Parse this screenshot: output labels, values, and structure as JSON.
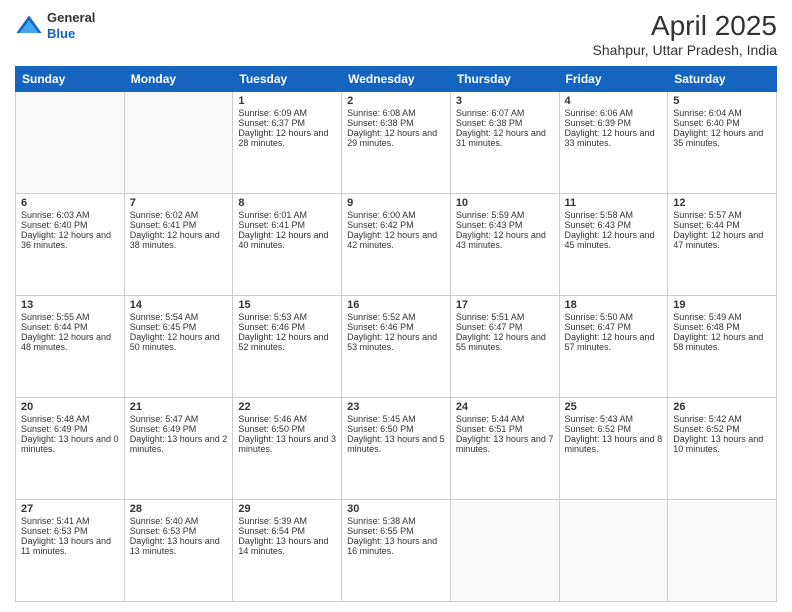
{
  "header": {
    "logo": {
      "general": "General",
      "blue": "Blue"
    },
    "title": "April 2025",
    "subtitle": "Shahpur, Uttar Pradesh, India"
  },
  "calendar": {
    "headers": [
      "Sunday",
      "Monday",
      "Tuesday",
      "Wednesday",
      "Thursday",
      "Friday",
      "Saturday"
    ],
    "rows": [
      [
        {
          "day": "",
          "content": ""
        },
        {
          "day": "",
          "content": ""
        },
        {
          "day": "1",
          "content": "Sunrise: 6:09 AM\nSunset: 6:37 PM\nDaylight: 12 hours and 28 minutes."
        },
        {
          "day": "2",
          "content": "Sunrise: 6:08 AM\nSunset: 6:38 PM\nDaylight: 12 hours and 29 minutes."
        },
        {
          "day": "3",
          "content": "Sunrise: 6:07 AM\nSunset: 6:38 PM\nDaylight: 12 hours and 31 minutes."
        },
        {
          "day": "4",
          "content": "Sunrise: 6:06 AM\nSunset: 6:39 PM\nDaylight: 12 hours and 33 minutes."
        },
        {
          "day": "5",
          "content": "Sunrise: 6:04 AM\nSunset: 6:40 PM\nDaylight: 12 hours and 35 minutes."
        }
      ],
      [
        {
          "day": "6",
          "content": "Sunrise: 6:03 AM\nSunset: 6:40 PM\nDaylight: 12 hours and 36 minutes."
        },
        {
          "day": "7",
          "content": "Sunrise: 6:02 AM\nSunset: 6:41 PM\nDaylight: 12 hours and 38 minutes."
        },
        {
          "day": "8",
          "content": "Sunrise: 6:01 AM\nSunset: 6:41 PM\nDaylight: 12 hours and 40 minutes."
        },
        {
          "day": "9",
          "content": "Sunrise: 6:00 AM\nSunset: 6:42 PM\nDaylight: 12 hours and 42 minutes."
        },
        {
          "day": "10",
          "content": "Sunrise: 5:59 AM\nSunset: 6:43 PM\nDaylight: 12 hours and 43 minutes."
        },
        {
          "day": "11",
          "content": "Sunrise: 5:58 AM\nSunset: 6:43 PM\nDaylight: 12 hours and 45 minutes."
        },
        {
          "day": "12",
          "content": "Sunrise: 5:57 AM\nSunset: 6:44 PM\nDaylight: 12 hours and 47 minutes."
        }
      ],
      [
        {
          "day": "13",
          "content": "Sunrise: 5:55 AM\nSunset: 6:44 PM\nDaylight: 12 hours and 48 minutes."
        },
        {
          "day": "14",
          "content": "Sunrise: 5:54 AM\nSunset: 6:45 PM\nDaylight: 12 hours and 50 minutes."
        },
        {
          "day": "15",
          "content": "Sunrise: 5:53 AM\nSunset: 6:46 PM\nDaylight: 12 hours and 52 minutes."
        },
        {
          "day": "16",
          "content": "Sunrise: 5:52 AM\nSunset: 6:46 PM\nDaylight: 12 hours and 53 minutes."
        },
        {
          "day": "17",
          "content": "Sunrise: 5:51 AM\nSunset: 6:47 PM\nDaylight: 12 hours and 55 minutes."
        },
        {
          "day": "18",
          "content": "Sunrise: 5:50 AM\nSunset: 6:47 PM\nDaylight: 12 hours and 57 minutes."
        },
        {
          "day": "19",
          "content": "Sunrise: 5:49 AM\nSunset: 6:48 PM\nDaylight: 12 hours and 58 minutes."
        }
      ],
      [
        {
          "day": "20",
          "content": "Sunrise: 5:48 AM\nSunset: 6:49 PM\nDaylight: 13 hours and 0 minutes."
        },
        {
          "day": "21",
          "content": "Sunrise: 5:47 AM\nSunset: 6:49 PM\nDaylight: 13 hours and 2 minutes."
        },
        {
          "day": "22",
          "content": "Sunrise: 5:46 AM\nSunset: 6:50 PM\nDaylight: 13 hours and 3 minutes."
        },
        {
          "day": "23",
          "content": "Sunrise: 5:45 AM\nSunset: 6:50 PM\nDaylight: 13 hours and 5 minutes."
        },
        {
          "day": "24",
          "content": "Sunrise: 5:44 AM\nSunset: 6:51 PM\nDaylight: 13 hours and 7 minutes."
        },
        {
          "day": "25",
          "content": "Sunrise: 5:43 AM\nSunset: 6:52 PM\nDaylight: 13 hours and 8 minutes."
        },
        {
          "day": "26",
          "content": "Sunrise: 5:42 AM\nSunset: 6:52 PM\nDaylight: 13 hours and 10 minutes."
        }
      ],
      [
        {
          "day": "27",
          "content": "Sunrise: 5:41 AM\nSunset: 6:53 PM\nDaylight: 13 hours and 11 minutes."
        },
        {
          "day": "28",
          "content": "Sunrise: 5:40 AM\nSunset: 6:53 PM\nDaylight: 13 hours and 13 minutes."
        },
        {
          "day": "29",
          "content": "Sunrise: 5:39 AM\nSunset: 6:54 PM\nDaylight: 13 hours and 14 minutes."
        },
        {
          "day": "30",
          "content": "Sunrise: 5:38 AM\nSunset: 6:55 PM\nDaylight: 13 hours and 16 minutes."
        },
        {
          "day": "",
          "content": ""
        },
        {
          "day": "",
          "content": ""
        },
        {
          "day": "",
          "content": ""
        }
      ]
    ]
  }
}
